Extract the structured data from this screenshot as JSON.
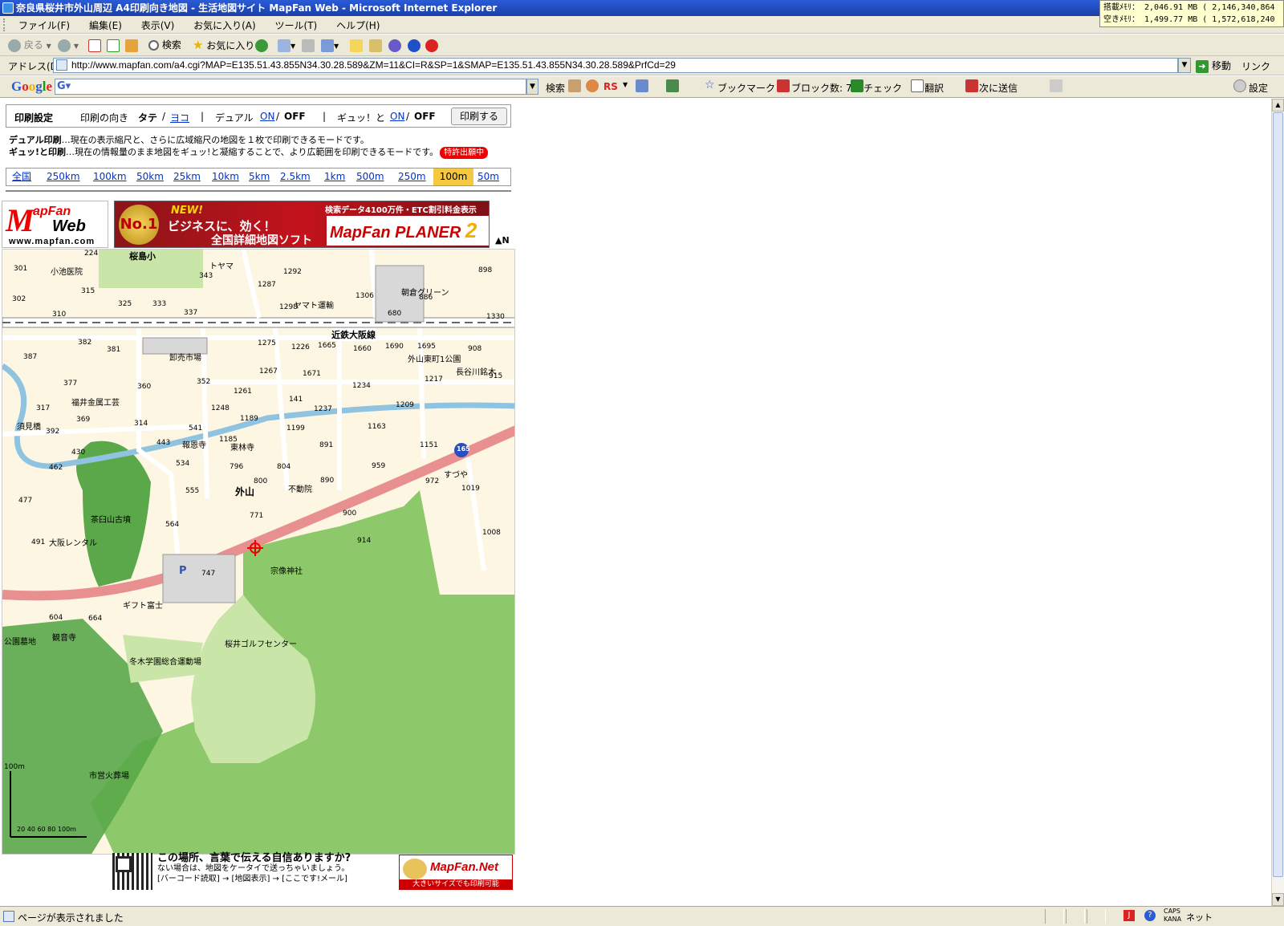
{
  "window": {
    "title": "奈良県桜井市外山周辺 A4印刷向き地図 - 生活地図サイト MapFan Web - Microsoft Internet Explorer",
    "memory_line1": "搭載ﾒﾓﾘ： 2,046.91 MB ( 2,146,340,864",
    "memory_line2": "空きﾒﾓﾘ： 1,499.77 MB ( 1,572,618,240"
  },
  "menubar": {
    "items": [
      "ファイル(F)",
      "編集(E)",
      "表示(V)",
      "お気に入り(A)",
      "ツール(T)",
      "ヘルプ(H)"
    ]
  },
  "toolbar": {
    "back": "戻る",
    "search": "検索",
    "favorites": "お気に入り"
  },
  "addressbar": {
    "label": "アドレス(D)",
    "url": "http://www.mapfan.com/a4.cgi?MAP=E135.51.43.855N34.30.28.589&ZM=11&CI=R&SP=1&SMAP=E135.51.43.855N34.30.28.589&PrfCd=29",
    "go": "移動",
    "links": "リンク"
  },
  "googlebar": {
    "logo": "Google",
    "search": "検索",
    "rs": "RS",
    "bookmark": "ブックマーク",
    "blocked": "ブロック数: 7",
    "check": "チェック",
    "translate": "翻訳",
    "send": "次に送信",
    "settings": "設定"
  },
  "print_settings": {
    "heading": "印刷設定",
    "orientation_label": "印刷の向き",
    "tate": "タテ",
    "slash": "/",
    "yoko": "ヨコ",
    "sep": "|",
    "dual_label": "デュアル",
    "on": "ON",
    "off": "OFF",
    "gyu_label": "ギュッ！と",
    "print_button": "印刷する"
  },
  "descriptions": {
    "dual_title": "デュアル印刷",
    "dual_text": "…現在の表示縮尺と、さらに広域縮尺の地図を１枚で印刷できるモードです。",
    "gyu_title": "ギュッ!と印刷",
    "gyu_text": "…現在の情報量のまま地図をギュッ!と凝縮することで、より広範囲を印刷できるモードです。",
    "patent": "特許出願中"
  },
  "scales": {
    "items": [
      "全国",
      "250km",
      "100km",
      "50km",
      "25km",
      "10km",
      "5km",
      "2.5km",
      "1km",
      "500m",
      "250m",
      "100m",
      "50m"
    ],
    "active": "100m"
  },
  "banner": {
    "logo_m": "M",
    "logo_apfan": "apFan",
    "logo_web": "Web",
    "logo_url": "www.mapfan.com",
    "badge": "No.1",
    "new": "NEW!",
    "line1": "ビジネスに、効く！",
    "line2": "全国詳細地図ソフト",
    "right_top": "検索データ4100万件・ETC割引料金表示",
    "product": "MapFan PLANER",
    "product_num": "2",
    "north": "▲N"
  },
  "map": {
    "labels": {
      "rail": "近鉄大阪線",
      "area": "外山",
      "golf": "桜井ゴルフセンター",
      "park": "冬木学園総合運動場",
      "shrine": "宗像神社",
      "tomb": "茶臼山古墳",
      "market": "卸売市場",
      "hosp": "小池医院",
      "toyama": "トヤマ",
      "yamato": "ヤマト運輸",
      "green": "朝倉グリーン",
      "park2": "外山東町1公園",
      "hasegawa": "長谷川銘木",
      "fukui": "福井金属工芸",
      "bridge": "須見橋",
      "hoonji": "報恩寺",
      "torinji": "東林寺",
      "fudoin": "不動院",
      "suya": "すづや",
      "rental": "大阪レンタル",
      "gift": "ギフト富士",
      "kannon": "観音寺",
      "cemetery": "公園墓地",
      "crematorium": "市営火葬場",
      "school": "桜島小",
      "route": "165",
      "parking": "P",
      "scale": "100m",
      "scale_ticks": "20 40 60 80 100m"
    },
    "numbers": [
      "301",
      "224",
      "315",
      "325",
      "333",
      "337",
      "343",
      "1287",
      "1292",
      "1298",
      "1306",
      "680",
      "886",
      "898",
      "1330",
      "302",
      "310",
      "387",
      "382",
      "381",
      "1275",
      "1226",
      "1665",
      "1660",
      "1690",
      "1695",
      "908",
      "1267",
      "1671",
      "1217",
      "915",
      "377",
      "360",
      "352",
      "1261",
      "141",
      "1234",
      "1209",
      "317",
      "369",
      "314",
      "1248",
      "1189",
      "1237",
      "1199",
      "1163",
      "392",
      "443",
      "541",
      "1185",
      "891",
      "1151",
      "430",
      "534",
      "796",
      "804",
      "959",
      "462",
      "555",
      "800",
      "890",
      "972",
      "1019",
      "477",
      "564",
      "771",
      "900",
      "1008",
      "914",
      "491",
      "747",
      "604",
      "664"
    ]
  },
  "bottom_ad": {
    "heading": "この場所、言葉で伝える自信ありますか?",
    "line1": "ない場合は、地図をケータイで送っちゃいましょう。",
    "line2": "[バーコード読取] → [地図表示] → [ここです!メール]",
    "brand": "MapFan.Net",
    "brand_sub": "大きいサイズでも印刷可能"
  },
  "status": {
    "text": "ページが表示されました",
    "caps": "CAPS",
    "kana": "KANA",
    "net": "ネット"
  }
}
